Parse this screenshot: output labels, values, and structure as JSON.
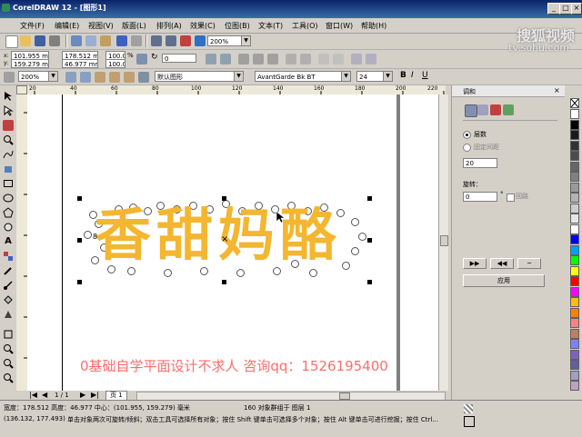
{
  "window": {
    "title": "CorelDRAW 12 - [图形1]",
    "controls": [
      "_",
      "□",
      "×"
    ]
  },
  "menubar": {
    "items": [
      "文件(F)",
      "编辑(E)",
      "视图(V)",
      "版面(L)",
      "排列(A)",
      "效果(C)",
      "位图(B)",
      "文本(T)",
      "工具(O)",
      "窗口(W)",
      "帮助(H)"
    ]
  },
  "toolbar": {
    "zoom": "200%",
    "x_pos": "101.955 mm",
    "y_pos": "159.279 mm",
    "width": "178.512 mm",
    "height": "46.977 mm",
    "scale_x": "100.0",
    "scale_y": "100.0",
    "scale_unit": "%",
    "angle": "0",
    "zoom2": "200%",
    "style": "默认图形",
    "font": "AvantGarde Bk BT",
    "font_size": "24"
  },
  "ruler": {
    "h_ticks": [
      "20",
      "40",
      "60",
      "80",
      "100",
      "120",
      "140",
      "160",
      "180",
      "200",
      "220"
    ],
    "unit": "毫米"
  },
  "canvas": {
    "artwork_text": "香甜妈酪",
    "watermark": "0基础自学平面设计不求人 咨询qq：1526195400",
    "node_label": "8",
    "center_marker": "×"
  },
  "docker": {
    "title": "调和",
    "option_layers": "层数",
    "option_spacing": "固定间距",
    "steps_value": "20",
    "rotate_label": "旋转：",
    "rotate_value": "0",
    "rotate_unit": "°",
    "loop_label": "回路",
    "apply_button": "应用"
  },
  "palette": {
    "colors": [
      "#ffffff",
      "#000000",
      "#1a1a1a",
      "#333333",
      "#4d4d4d",
      "#666666",
      "#808080",
      "#999999",
      "#b3b3b3",
      "#cccccc",
      "#e6e6e6",
      "#ffffff",
      "#0000ff",
      "#00a0ff",
      "#00ff00",
      "#ffff00",
      "#ff0000",
      "#ff00ff",
      "#ffc000",
      "#ff8000",
      "#ff8080",
      "#c08060",
      "#8080ff",
      "#8060c0",
      "#6060a0",
      "#a0a0c0",
      "#c0a0c0"
    ]
  },
  "pagenav": {
    "page_count": "1 / 1",
    "page_tab": "页 1"
  },
  "status": {
    "size": "宽度：178.512  高度：46.977  中心：(101.955, 159.279)  毫米",
    "object_info": "160 对象群组于 图层 1",
    "cursor": "(136.132, 177.493)",
    "hint": "单击对象两次可旋转/倾斜；双击工具可选择所有对象；按住 Shift 键单击可选择多个对象；按住 Alt 键单击可进行挖掘；按住 Ctrl..."
  },
  "watermark_site": {
    "brand": "搜狐视频",
    "url": "tv.sohu.com"
  }
}
